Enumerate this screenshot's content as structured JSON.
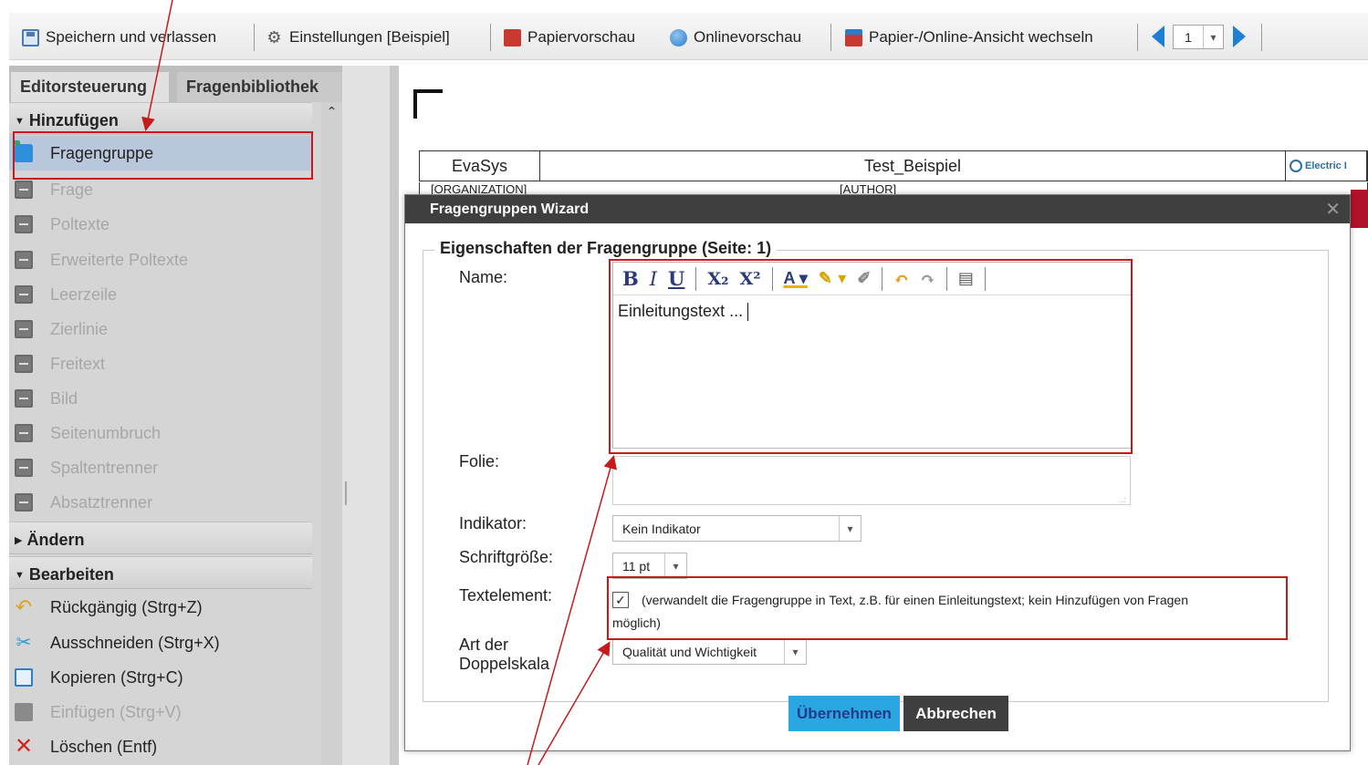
{
  "toolbar": {
    "save_label": "Speichern und verlassen",
    "settings_label": "Einstellungen [Beispiel]",
    "paper_preview_label": "Papiervorschau",
    "online_preview_label": "Onlinevorschau",
    "switch_view_label": "Papier-/Online-Ansicht wechseln",
    "page_value": "1",
    "icons": [
      "save-icon",
      "settings-gear-icon",
      "pdf-icon",
      "globe-icon",
      "pdf-switch-icon",
      "arrow-left-icon",
      "arrow-right-icon"
    ]
  },
  "left_panel": {
    "tabs": [
      {
        "label": "Editorsteuerung"
      },
      {
        "label": "Fragenbibliothek"
      }
    ],
    "sections": {
      "add": "Hinzufügen",
      "change": "Ändern",
      "edit": "Bearbeiten"
    },
    "add_items": [
      {
        "label": "Fragengruppe",
        "enabled": true,
        "selected": true
      },
      {
        "label": "Frage",
        "enabled": false
      },
      {
        "label": "Poltexte",
        "enabled": false
      },
      {
        "label": "Erweiterte Poltexte",
        "enabled": false
      },
      {
        "label": "Leerzeile",
        "enabled": false
      },
      {
        "label": "Zierlinie",
        "enabled": false
      },
      {
        "label": "Freitext",
        "enabled": false
      },
      {
        "label": "Bild",
        "enabled": false
      },
      {
        "label": "Seitenumbruch",
        "enabled": false
      },
      {
        "label": "Spaltentrenner",
        "enabled": false
      },
      {
        "label": "Absatztrenner",
        "enabled": false
      }
    ],
    "edit_items": [
      {
        "label": "Rückgängig (Strg+Z)",
        "enabled": true
      },
      {
        "label": "Ausschneiden (Strg+X)",
        "enabled": true
      },
      {
        "label": "Kopieren (Strg+C)",
        "enabled": true
      },
      {
        "label": "Einfügen (Strg+V)",
        "enabled": false
      },
      {
        "label": "Löschen (Entf)",
        "enabled": true
      }
    ]
  },
  "document": {
    "header": {
      "organization": "EvaSys",
      "title": "Test_Beispiel",
      "logo_text": "Electric I"
    },
    "subheader": {
      "organization": "[ORGANIZATION]",
      "author": "[AUTHOR]"
    }
  },
  "wizard": {
    "title": "Fragengruppen Wizard",
    "close_glyph": "✕",
    "legend": "Eigenschaften der Fragengruppe (Seite: 1)",
    "labels": {
      "name": "Name:",
      "folie": "Folie:",
      "indikator": "Indikator:",
      "font_size": "Schriftgröße:",
      "text_element": "Textelement:",
      "dual_scale_line1": "Art der",
      "dual_scale_line2": "Doppelskala"
    },
    "name_value": "Einleitungstext ...",
    "indikator_value": "Kein Indikator",
    "font_size_value": "11 pt",
    "text_element_checked": true,
    "text_element_hint_line1": "(verwandelt die Fragengruppe in Text, z.B. für einen Einleitungstext; kein Hinzufügen von Fragen",
    "text_element_hint_line2": "möglich)",
    "dual_scale_value": "Qualität und Wichtigkeit",
    "apply_label": "Übernehmen",
    "cancel_label": "Abbrechen",
    "editor_toolbar": {
      "bold": "B",
      "italic": "I",
      "underline": "U",
      "subscript": "X₂",
      "superscript": "X²"
    }
  },
  "colors": {
    "annotation": "#c71a1a",
    "apply_button": "#2aa7e0",
    "cancel_button": "#3f3f3f",
    "selected_item": "#b9c7dc"
  }
}
